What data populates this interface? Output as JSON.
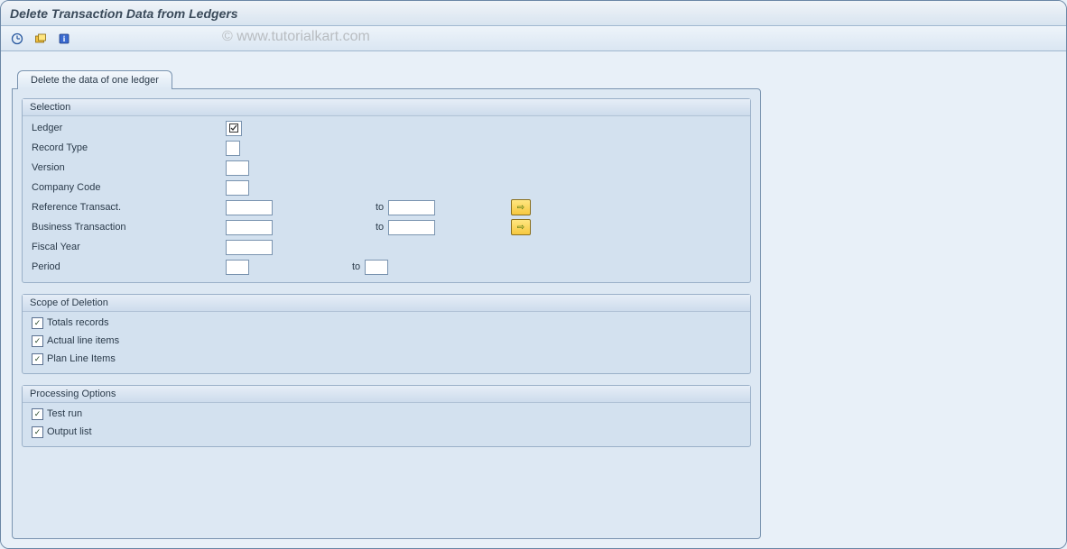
{
  "title": "Delete Transaction Data from Ledgers",
  "watermark": "© www.tutorialkart.com",
  "toolbar": {
    "execute_tip": "Execute",
    "variant_tip": "Get Variant",
    "info_tip": "Information"
  },
  "tab": {
    "label": "Delete the data of one ledger"
  },
  "groups": {
    "selection": {
      "title": "Selection",
      "fields": {
        "ledger": {
          "label": "Ledger",
          "value": "",
          "checked": "⊡"
        },
        "record_type": {
          "label": "Record Type",
          "value": ""
        },
        "version": {
          "label": "Version",
          "value": ""
        },
        "company_code": {
          "label": "Company Code",
          "value": ""
        },
        "reference_transact": {
          "label": "Reference Transact.",
          "from": "",
          "to_label": "to",
          "to": ""
        },
        "business_transaction": {
          "label": "Business Transaction",
          "from": "",
          "to_label": "to",
          "to": ""
        },
        "fiscal_year": {
          "label": "Fiscal Year",
          "value": ""
        },
        "period": {
          "label": "Period",
          "from": "",
          "to_label": "to",
          "to": ""
        }
      }
    },
    "scope": {
      "title": "Scope of Deletion",
      "options": [
        {
          "label": "Totals records",
          "checked": true
        },
        {
          "label": "Actual line items",
          "checked": true
        },
        {
          "label": "Plan Line Items",
          "checked": true
        }
      ]
    },
    "processing": {
      "title": "Processing Options",
      "options": [
        {
          "label": "Test run",
          "checked": true
        },
        {
          "label": "Output list",
          "checked": true
        }
      ]
    }
  },
  "glyphs": {
    "check": "✓",
    "arrow_right": "⇨"
  }
}
